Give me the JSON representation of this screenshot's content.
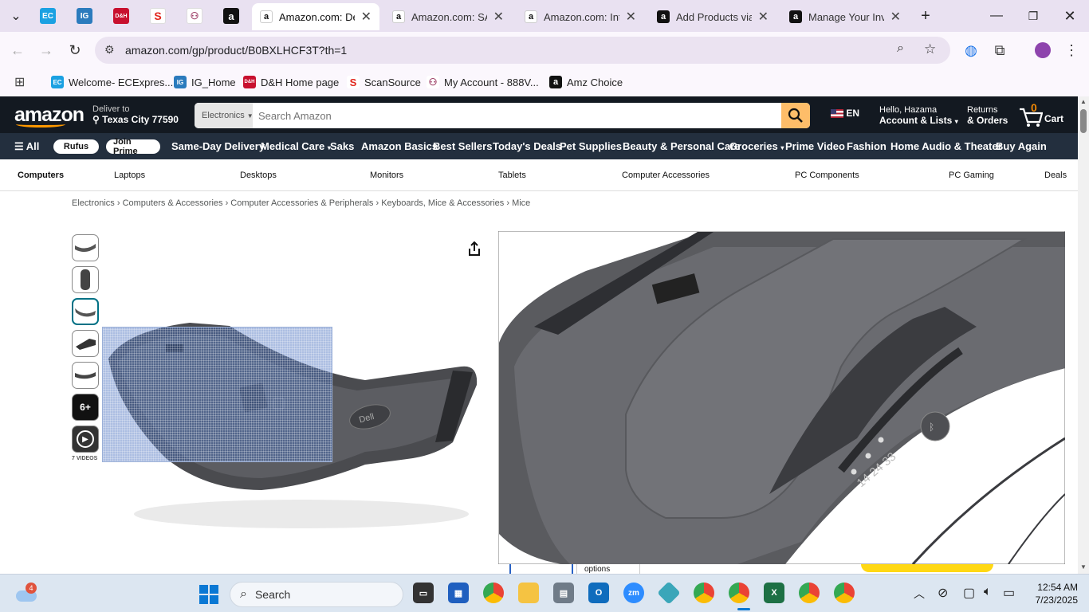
{
  "browser": {
    "tabs": [
      {
        "title": "Amazon.com: Del",
        "active": true
      },
      {
        "title": "Amazon.com: SAT",
        "active": false
      },
      {
        "title": "Amazon.com: Inte",
        "active": false
      },
      {
        "title": "Add Products via",
        "active": false
      },
      {
        "title": "Manage Your Inve",
        "active": false
      }
    ],
    "pinned_tab_icons": [
      "ec-icon",
      "ig-icon",
      "dh-icon",
      "scansource-icon",
      "myaccount-icon",
      "amazon-icon"
    ],
    "url": "amazon.com/gp/product/B0BXLHCF3T?th=1",
    "bookmarks": [
      {
        "label": "Welcome- ECExpres...",
        "icon": "ec-icon"
      },
      {
        "label": "IG_Home",
        "icon": "ig-icon"
      },
      {
        "label": "D&H Home page",
        "icon": "dh-icon"
      },
      {
        "label": "ScanSource",
        "icon": "scansource-icon"
      },
      {
        "label": "My Account - 888V...",
        "icon": "myaccount-icon"
      },
      {
        "label": "Amz Choice",
        "icon": "amazon-icon"
      }
    ]
  },
  "amazon": {
    "logo": "amazon",
    "deliver_label": "Deliver to",
    "deliver_location": "Texas City 77590",
    "search_category": "Electronics",
    "search_placeholder": "Search Amazon",
    "language": "EN",
    "account_greeting": "Hello, Hazama",
    "account_label": "Account & Lists",
    "returns_label": "Returns",
    "orders_label": "& Orders",
    "cart_count": "0",
    "cart_label": "Cart",
    "nav": {
      "all": "All",
      "rufus": "Rufus",
      "join_prime": "Join Prime",
      "links": [
        "Same-Day Delivery",
        "Medical Care",
        "Saks",
        "Amazon Basics",
        "Best Sellers",
        "Today's Deals",
        "Pet Supplies",
        "Beauty & Personal Care",
        "Groceries",
        "Prime Video",
        "Fashion",
        "Home Audio & Theater",
        "Buy Again"
      ]
    },
    "categories": [
      "Computers",
      "Laptops",
      "Desktops",
      "Monitors",
      "Tablets",
      "Computer Accessories",
      "PC Components",
      "PC Gaming",
      "Deals"
    ],
    "breadcrumb": [
      "Electronics",
      "Computers & Accessories",
      "Computer Accessories & Peripherals",
      "Keyboards, Mice & Accessories",
      "Mice"
    ],
    "thumbnail_more": "6+",
    "videos_label": "7 VIDEOS",
    "below_fold_text": "options",
    "product_image_alt": "Dell",
    "zoom_leds": "14 24 33"
  },
  "taskbar": {
    "weather_badge": "4",
    "search_label": "Search",
    "time": "12:54 AM",
    "date": "7/23/2025"
  },
  "colors": {
    "amazon_dark": "#131921",
    "amazon_nav": "#232f3e",
    "amazon_orange": "#ff9900",
    "search_button": "#febd69"
  }
}
